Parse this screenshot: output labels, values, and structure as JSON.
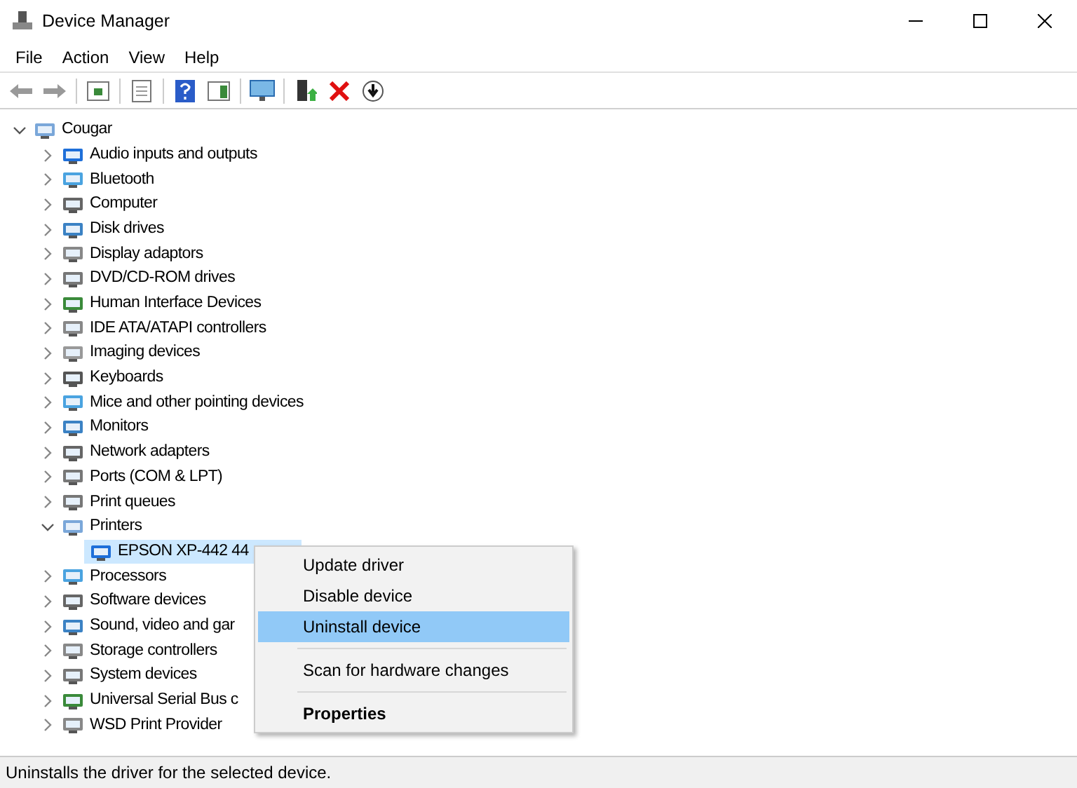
{
  "window": {
    "title": "Device Manager"
  },
  "menu": [
    "File",
    "Action",
    "View",
    "Help"
  ],
  "tree": {
    "label": "Cougar",
    "expanded": true,
    "selected": false,
    "children": [
      {
        "label": "Audio inputs and outputs",
        "expanded": false,
        "selected": false
      },
      {
        "label": "Bluetooth",
        "expanded": false,
        "selected": false
      },
      {
        "label": "Computer",
        "expanded": false,
        "selected": false
      },
      {
        "label": "Disk drives",
        "expanded": false,
        "selected": false
      },
      {
        "label": "Display adaptors",
        "expanded": false,
        "selected": false
      },
      {
        "label": "DVD/CD-ROM drives",
        "expanded": false,
        "selected": false
      },
      {
        "label": "Human Interface Devices",
        "expanded": false,
        "selected": false
      },
      {
        "label": "IDE ATA/ATAPI controllers",
        "expanded": false,
        "selected": false
      },
      {
        "label": "Imaging devices",
        "expanded": false,
        "selected": false
      },
      {
        "label": "Keyboards",
        "expanded": false,
        "selected": false
      },
      {
        "label": "Mice and other pointing devices",
        "expanded": false,
        "selected": false
      },
      {
        "label": "Monitors",
        "expanded": false,
        "selected": false
      },
      {
        "label": "Network adapters",
        "expanded": false,
        "selected": false
      },
      {
        "label": "Ports (COM & LPT)",
        "expanded": false,
        "selected": false
      },
      {
        "label": "Print queues",
        "expanded": false,
        "selected": false
      },
      {
        "label": "Printers",
        "expanded": true,
        "selected": false,
        "children": [
          {
            "label": "EPSON XP-442 44",
            "selected": true
          }
        ]
      },
      {
        "label": "Processors",
        "expanded": false,
        "selected": false
      },
      {
        "label": "Software devices",
        "expanded": false,
        "selected": false
      },
      {
        "label": "Sound, video and gar",
        "expanded": false,
        "selected": false
      },
      {
        "label": "Storage controllers",
        "expanded": false,
        "selected": false
      },
      {
        "label": "System devices",
        "expanded": false,
        "selected": false
      },
      {
        "label": "Universal Serial Bus c",
        "expanded": false,
        "selected": false
      },
      {
        "label": "WSD Print Provider",
        "expanded": false,
        "selected": false
      }
    ]
  },
  "context_menu": [
    {
      "kind": "item",
      "label": "Update driver",
      "selected": false,
      "bold": false
    },
    {
      "kind": "item",
      "label": "Disable device",
      "selected": false,
      "bold": false
    },
    {
      "kind": "item",
      "label": "Uninstall device",
      "selected": true,
      "bold": false
    },
    {
      "kind": "separator"
    },
    {
      "kind": "item",
      "label": "Scan for hardware changes",
      "selected": false,
      "bold": false
    },
    {
      "kind": "separator"
    },
    {
      "kind": "item",
      "label": "Properties",
      "selected": false,
      "bold": true
    }
  ],
  "status_bar": "Uninstalls the driver for the selected device."
}
